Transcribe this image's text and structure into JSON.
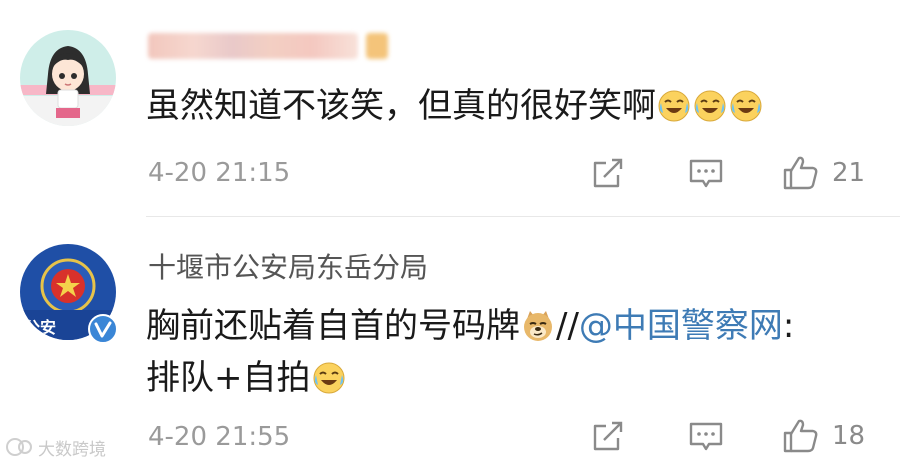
{
  "comments": [
    {
      "username": "",
      "username_blurred": true,
      "text_parts": {
        "main": "虽然知道不该笑，但真的很好笑啊"
      },
      "emojis": [
        "laugh-cry-emoji",
        "laugh-cry-emoji",
        "laugh-cry-emoji"
      ],
      "time": "4-20 21:15",
      "like_count": "21"
    },
    {
      "username": "十堰市公安局东岳分局",
      "verified": true,
      "avatar_label": "公安",
      "text_parts": {
        "before_emoji": "胸前还贴着自首的号码牌",
        "after_emoji": "//",
        "mention": "@中国警察网",
        "after_mention": ":",
        "line2": "排队+自拍"
      },
      "emojis": [
        "doge-emoji",
        "laugh-cry-emoji"
      ],
      "time": "4-20 21:55",
      "like_count": "18"
    }
  ],
  "watermark": {
    "text": "大数跨境"
  },
  "colors": {
    "mention": "#3e7bb5",
    "meta": "#9a9a9a",
    "icon": "#8a8a8a",
    "text": "#1a1a1a"
  }
}
